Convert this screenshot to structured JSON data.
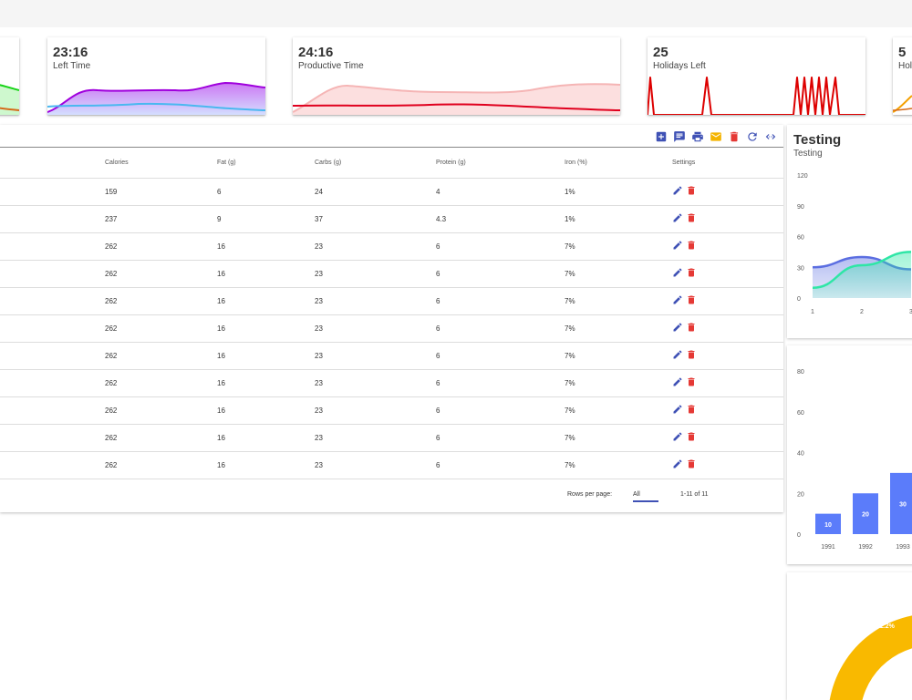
{
  "stat_cards": [
    {
      "value": "",
      "label": ""
    },
    {
      "value": "23:16",
      "label": "Left Time"
    },
    {
      "value": "24:16",
      "label": "Productive Time"
    },
    {
      "value": "25",
      "label": "Holidays Left"
    },
    {
      "value": "5",
      "label": "Hol"
    }
  ],
  "table": {
    "headers": [
      "",
      "Calories",
      "Fat (g)",
      "Carbs (g)",
      "Protein (g)",
      "Iron (%)",
      "Settings"
    ],
    "rows": [
      [
        "",
        "159",
        "6",
        "24",
        "4",
        "1%"
      ],
      [
        "",
        "237",
        "9",
        "37",
        "4.3",
        "1%"
      ],
      [
        "",
        "262",
        "16",
        "23",
        "6",
        "7%"
      ],
      [
        "",
        "262",
        "16",
        "23",
        "6",
        "7%"
      ],
      [
        "",
        "262",
        "16",
        "23",
        "6",
        "7%"
      ],
      [
        "",
        "262",
        "16",
        "23",
        "6",
        "7%"
      ],
      [
        "",
        "262",
        "16",
        "23",
        "6",
        "7%"
      ],
      [
        "",
        "262",
        "16",
        "23",
        "6",
        "7%"
      ],
      [
        "",
        "262",
        "16",
        "23",
        "6",
        "7%"
      ],
      [
        "",
        "262",
        "16",
        "23",
        "6",
        "7%"
      ],
      [
        "",
        "262",
        "16",
        "23",
        "6",
        "7%"
      ]
    ],
    "footer": {
      "rows_per_page_label": "Rows per page:",
      "rows_per_page_value": "All",
      "range": "1-11 of 11"
    },
    "toolbar_icons": [
      "add-box-icon",
      "comment-icon",
      "print-icon",
      "email-icon",
      "delete-icon",
      "refresh-icon",
      "code-icon"
    ],
    "colors": {
      "edit": "#3f51b5",
      "delete": "#e53935",
      "email": "#f4b400",
      "toolbar": "#3f51b5"
    }
  },
  "testing_card": {
    "title": "Testing",
    "subtitle": "Testing"
  },
  "chart_data": [
    {
      "type": "area",
      "title": "Testing",
      "subtitle": "Testing",
      "x": [
        1,
        2,
        3
      ],
      "ylim": [
        0,
        120
      ],
      "yticks": [
        0,
        30,
        60,
        90,
        120
      ],
      "series": [
        {
          "values": [
            30,
            40,
            28
          ],
          "color": "#5b6ee1"
        },
        {
          "values": [
            10,
            32,
            45
          ],
          "color": "#2ee6a6"
        }
      ]
    },
    {
      "type": "bar",
      "categories": [
        "1991",
        "1992",
        "1993"
      ],
      "values": [
        10,
        20,
        30
      ],
      "ylim": [
        0,
        80
      ],
      "yticks": [
        0,
        20,
        40,
        60,
        80
      ],
      "color": "#5b7cfa"
    },
    {
      "type": "pie",
      "labels": [
        "22.2%"
      ],
      "values": [
        22.2
      ],
      "color": "#f9b900"
    }
  ]
}
